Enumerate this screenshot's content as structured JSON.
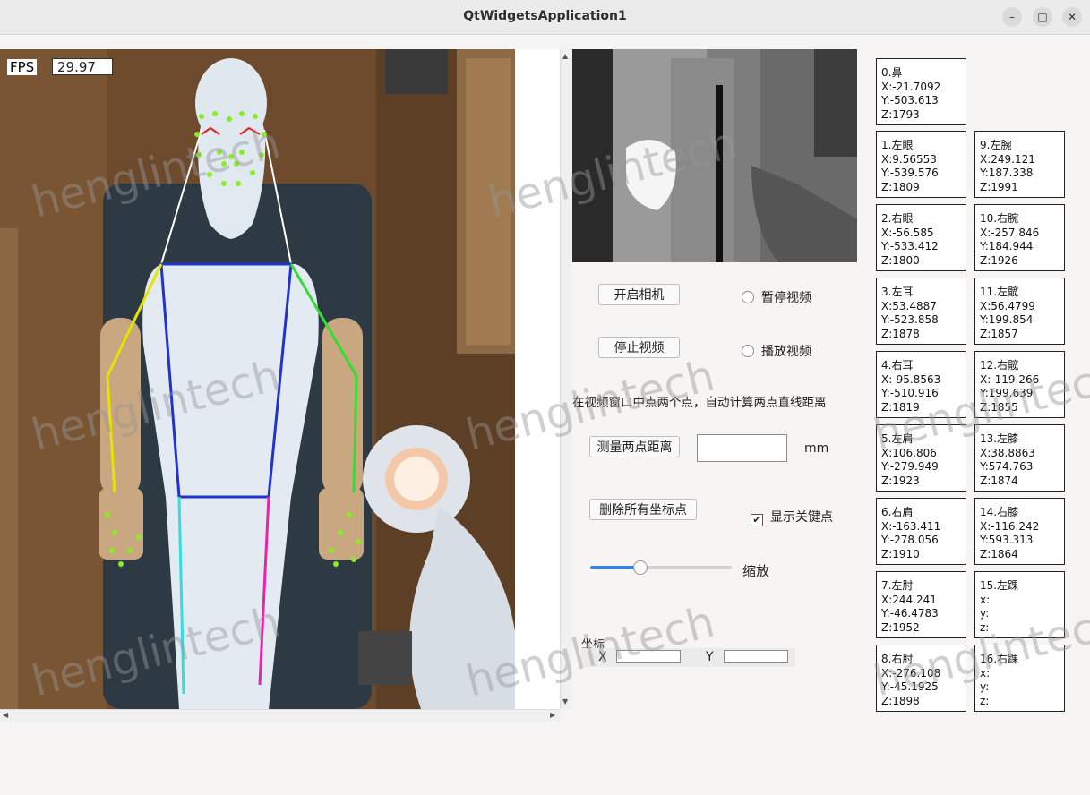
{
  "window": {
    "title": "QtWidgetsApplication1",
    "minimize": "–",
    "maximize": "□",
    "close": "✕"
  },
  "fps": {
    "label": "FPS",
    "value": "29.97"
  },
  "controls": {
    "open_camera": "开启相机",
    "stop_video": "停止视频",
    "pause_video": "暂停视频",
    "play_video": "播放视频",
    "instruction": "在视频窗口中点两个点，自动计算两点直线距离",
    "measure": "测量两点距离",
    "unit": "mm",
    "delete_points": "删除所有坐标点",
    "show_keypoints": "显示关键点",
    "show_keypoints_checked": true,
    "zoom_label": "缩放",
    "zoom_level": 0.35,
    "coords_label": "坐标",
    "x_label": "X",
    "y_label": "Y"
  },
  "keypoints": [
    {
      "name": "0.鼻",
      "x": "X:-21.7092",
      "y": "Y:-503.613",
      "z": "Z:1793"
    },
    {
      "name": "1.左眼",
      "x": "X:9.56553",
      "y": "Y:-539.576",
      "z": "Z:1809"
    },
    {
      "name": "2.右眼",
      "x": "X:-56.585",
      "y": "Y:-533.412",
      "z": "Z:1800"
    },
    {
      "name": "3.左耳",
      "x": "X:53.4887",
      "y": "Y:-523.858",
      "z": "Z:1878"
    },
    {
      "name": "4.右耳",
      "x": "X:-95.8563",
      "y": "Y:-510.916",
      "z": "Z:1819"
    },
    {
      "name": "5.左肩",
      "x": "X:106.806",
      "y": "Y:-279.949",
      "z": "Z:1923"
    },
    {
      "name": "6.右肩",
      "x": "X:-163.411",
      "y": "Y:-278.056",
      "z": "Z:1910"
    },
    {
      "name": "7.左肘",
      "x": "X:244.241",
      "y": "Y:-46.4783",
      "z": "Z:1952"
    },
    {
      "name": "8.右肘",
      "x": "X:-276.108",
      "y": "Y:-45.1925",
      "z": "Z:1898"
    },
    {
      "name": "9.左腕",
      "x": "X:249.121",
      "y": "Y:187.338",
      "z": "Z:1991"
    },
    {
      "name": "10.右腕",
      "x": "X:-257.846",
      "y": "Y:184.944",
      "z": "Z:1926"
    },
    {
      "name": "11.左髋",
      "x": "X:56.4799",
      "y": "Y:199.854",
      "z": "Z:1857"
    },
    {
      "name": "12.右髋",
      "x": "X:-119.266",
      "y": "Y:199.639",
      "z": "Z:1855"
    },
    {
      "name": "13.左膝",
      "x": "X:38.8863",
      "y": "Y:574.763",
      "z": "Z:1874"
    },
    {
      "name": "14.右膝",
      "x": "X:-116.242",
      "y": "Y:593.313",
      "z": "Z:1864"
    },
    {
      "name": "15.左踝",
      "x": "x:",
      "y": "y:",
      "z": "z:"
    },
    {
      "name": "16.右踝",
      "x": "x:",
      "y": "y:",
      "z": "z:"
    }
  ],
  "watermark": "henglintech"
}
